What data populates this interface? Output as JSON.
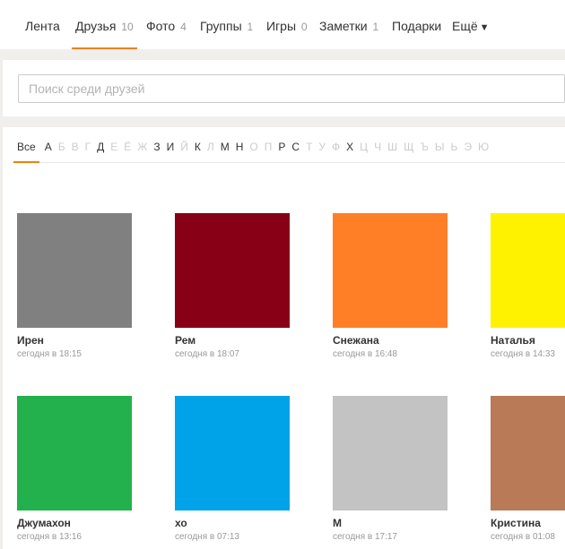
{
  "nav": [
    {
      "label": "Лента",
      "count": ""
    },
    {
      "label": "Друзья",
      "count": "10"
    },
    {
      "label": "Фото",
      "count": "4"
    },
    {
      "label": "Группы",
      "count": "1"
    },
    {
      "label": "Игры",
      "count": "0"
    },
    {
      "label": "Заметки",
      "count": "1"
    },
    {
      "label": "Подарки",
      "count": ""
    },
    {
      "label": "Ещё",
      "count": "",
      "arrow": "▼"
    }
  ],
  "search": {
    "placeholder": "Поиск среди друзей",
    "value": ""
  },
  "alphabet": [
    {
      "l": "Все",
      "s": "sel"
    },
    {
      "l": "А",
      "s": "on"
    },
    {
      "l": "Б",
      "s": "off"
    },
    {
      "l": "В",
      "s": "off"
    },
    {
      "l": "Г",
      "s": "off"
    },
    {
      "l": "Д",
      "s": "on"
    },
    {
      "l": "Е",
      "s": "off"
    },
    {
      "l": "Ё",
      "s": "off"
    },
    {
      "l": "Ж",
      "s": "off"
    },
    {
      "l": "З",
      "s": "on"
    },
    {
      "l": "И",
      "s": "on"
    },
    {
      "l": "Й",
      "s": "off"
    },
    {
      "l": "К",
      "s": "on"
    },
    {
      "l": "Л",
      "s": "off"
    },
    {
      "l": "М",
      "s": "on"
    },
    {
      "l": "Н",
      "s": "on"
    },
    {
      "l": "О",
      "s": "off"
    },
    {
      "l": "П",
      "s": "off"
    },
    {
      "l": "Р",
      "s": "on"
    },
    {
      "l": "С",
      "s": "on"
    },
    {
      "l": "Т",
      "s": "off"
    },
    {
      "l": "У",
      "s": "off"
    },
    {
      "l": "Ф",
      "s": "off"
    },
    {
      "l": "Х",
      "s": "on"
    },
    {
      "l": "Ц",
      "s": "off"
    },
    {
      "l": "Ч",
      "s": "off"
    },
    {
      "l": "Ш",
      "s": "off"
    },
    {
      "l": "Щ",
      "s": "off"
    },
    {
      "l": "Ъ",
      "s": "off"
    },
    {
      "l": "Ы",
      "s": "off"
    },
    {
      "l": "Ь",
      "s": "off"
    },
    {
      "l": "Э",
      "s": "off"
    },
    {
      "l": "Ю",
      "s": "off"
    }
  ],
  "friends": [
    {
      "name": "Ирен",
      "time": "сегодня в 18:15",
      "color": "#808080"
    },
    {
      "name": "Рем",
      "time": "сегодня в 18:07",
      "color": "#880015"
    },
    {
      "name": "Снежана",
      "time": "сегодня в 16:48",
      "color": "#ff7f27"
    },
    {
      "name": "Наталья",
      "time": "сегодня в 14:33",
      "color": "#fff200"
    },
    {
      "name": "Джумахон",
      "time": "сегодня в 13:16",
      "color": "#22b14c"
    },
    {
      "name": "хо",
      "time": "сегодня в 07:13",
      "color": "#00a2e8"
    },
    {
      "name": "М",
      "time": "сегодня в 17:17",
      "color": "#c3c3c3"
    },
    {
      "name": "Кристина",
      "time": "сегодня в 01:08",
      "color": "#b97a57"
    }
  ],
  "accent": "#ee8208"
}
